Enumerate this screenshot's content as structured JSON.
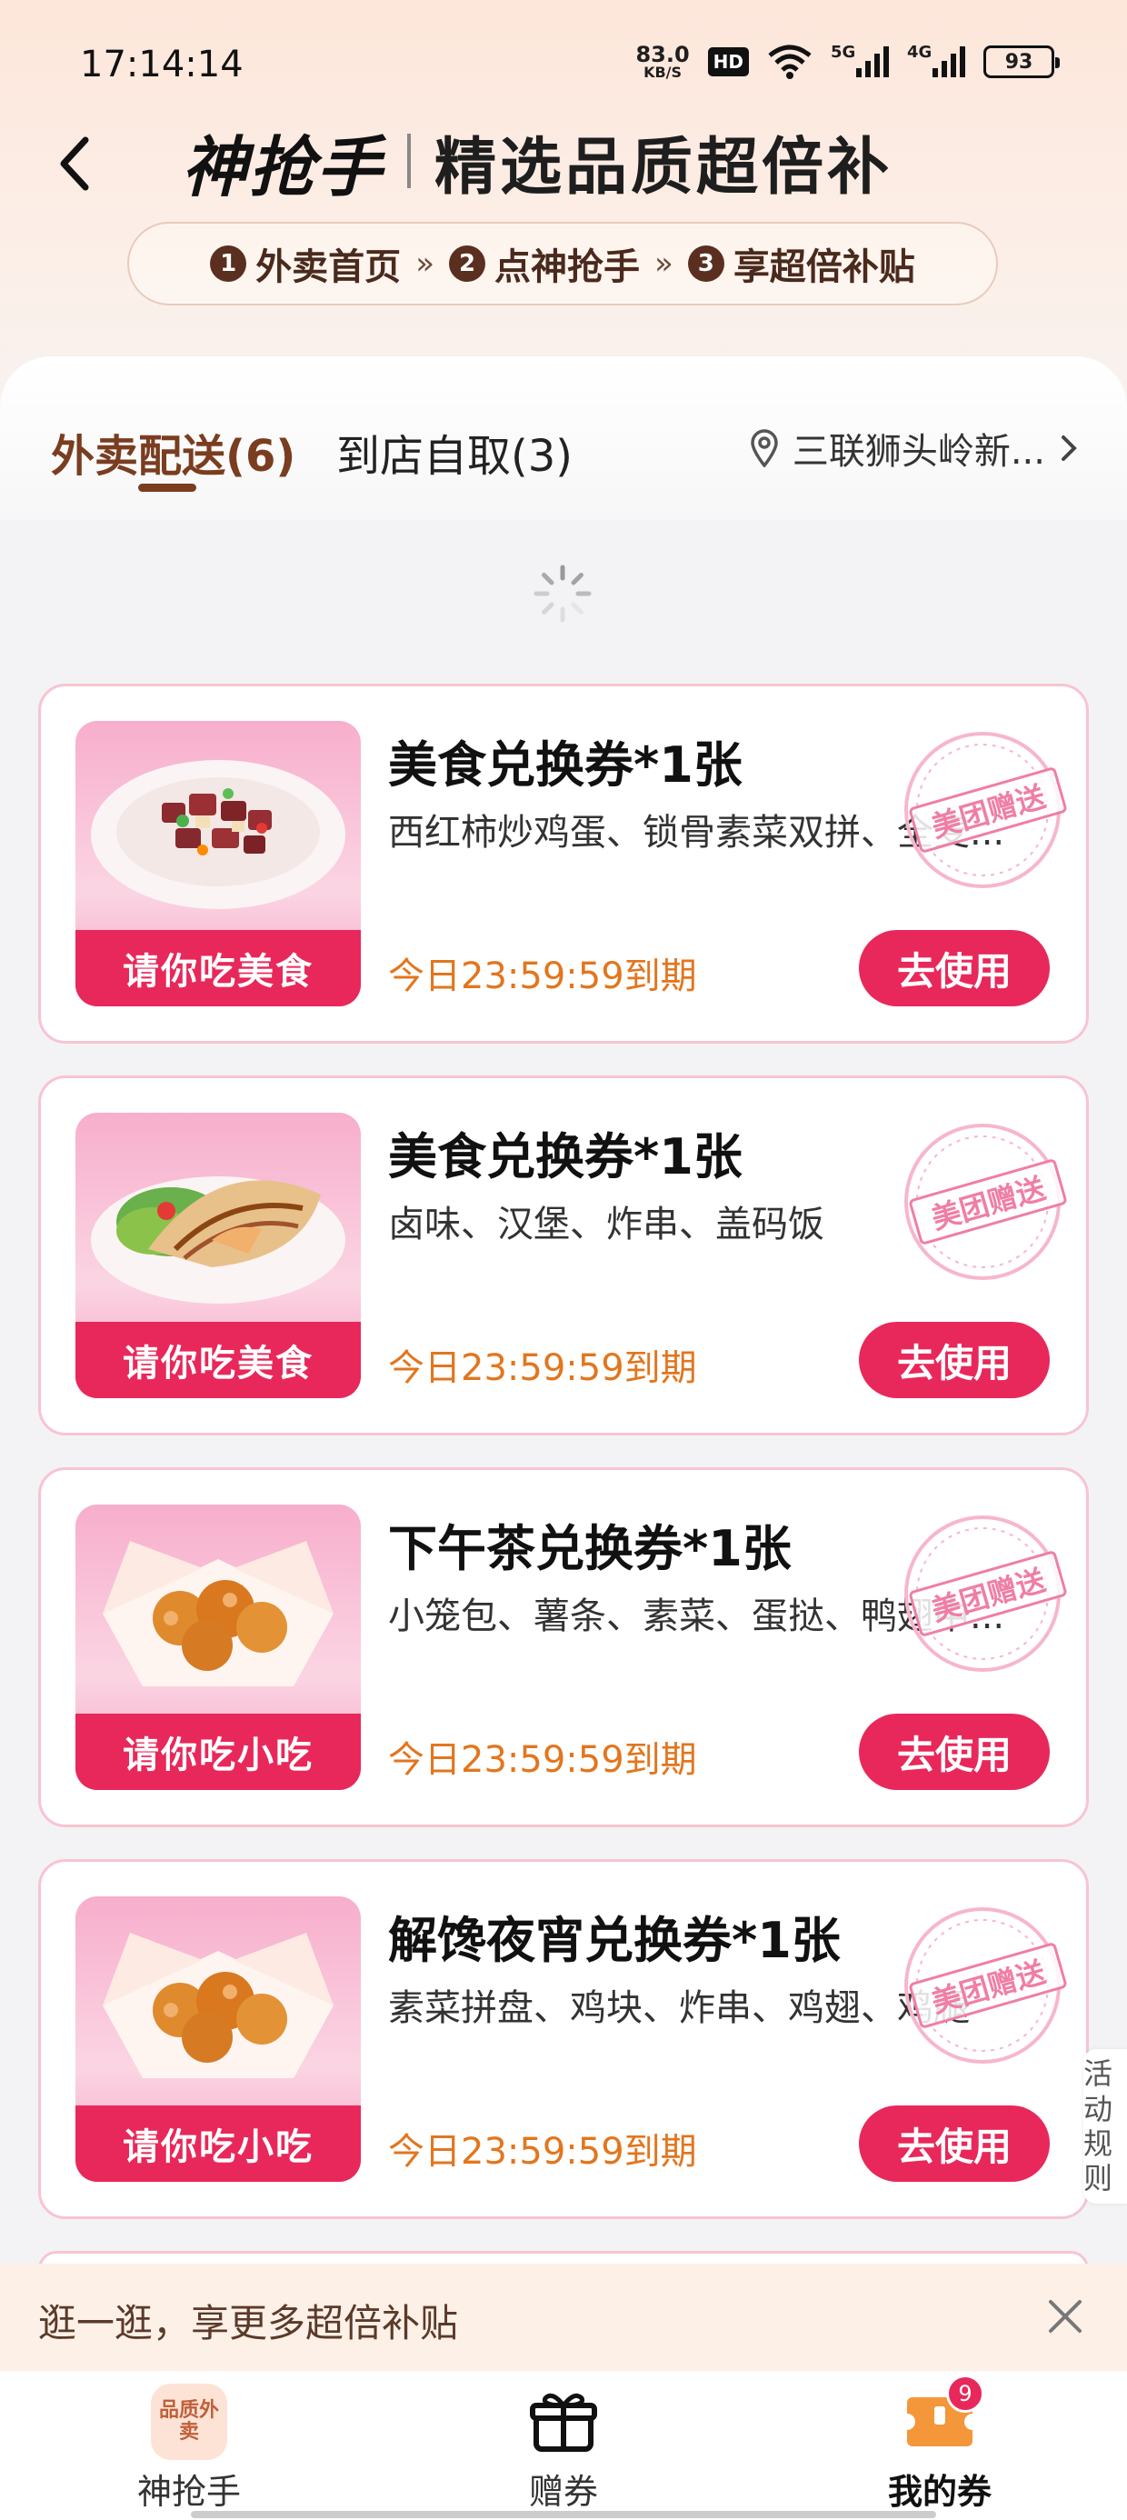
{
  "status_bar": {
    "time": "17:14:14",
    "net_speed_value": "83.0",
    "net_speed_unit": "KB/S",
    "hd_label": "HD",
    "signal_1_label": "5G",
    "signal_2_label": "4G",
    "battery": "93"
  },
  "header": {
    "brand_logo": "神抢手",
    "title": "精选品质超倍补",
    "steps": [
      {
        "num": "1",
        "label": "外卖首页"
      },
      {
        "num": "2",
        "label": "点神抢手"
      },
      {
        "num": "3",
        "label": "享超倍补贴"
      }
    ],
    "step_arrow": "»"
  },
  "tabs": {
    "delivery": "外卖配送(6)",
    "pickup": "到店自取(3)",
    "location": "三联狮头岭新..."
  },
  "coupons": [
    {
      "title": "美食兑换券*1张",
      "desc": "西红柿炒鸡蛋、锁骨素菜双拼、全麦...",
      "thumb_label": "请你吃美食",
      "expire": "今日23:59:59到期",
      "button": "去使用",
      "stamp": "美团赠送"
    },
    {
      "title": "美食兑换券*1张",
      "desc": "卤味、汉堡、炸串、盖码饭",
      "thumb_label": "请你吃美食",
      "expire": "今日23:59:59到期",
      "button": "去使用",
      "stamp": "美团赠送"
    },
    {
      "title": "下午茶兑换券*1张",
      "desc": "小笼包、薯条、素菜、蛋挞、鸭翅中...",
      "thumb_label": "请你吃小吃",
      "expire": "今日23:59:59到期",
      "button": "去使用",
      "stamp": "美团赠送"
    },
    {
      "title": "解馋夜宵兑换券*1张",
      "desc": "素菜拼盘、鸡块、炸串、鸡翅、鸡腿",
      "thumb_label": "请你吃小吃",
      "expire": "今日23:59:59到期",
      "button": "去使用",
      "stamp": "美团赠送"
    }
  ],
  "rules_tab": "活动规则",
  "promo_bar": {
    "text": "逛一逛，享更多超倍补贴"
  },
  "bottom_nav": [
    {
      "label": "神抢手",
      "icon_text": "品质外卖"
    },
    {
      "label": "赠券"
    },
    {
      "label": "我的券",
      "badge": "9"
    }
  ],
  "colors": {
    "accent": "#e8285a",
    "brown": "#7a3d1f",
    "expire": "#e2761e"
  },
  "icons": [
    "back-arrow-icon",
    "location-pin-icon",
    "chevron-right-icon",
    "loading-spinner-icon",
    "close-icon",
    "gift-icon",
    "coupon-icon",
    "wifi-icon"
  ]
}
